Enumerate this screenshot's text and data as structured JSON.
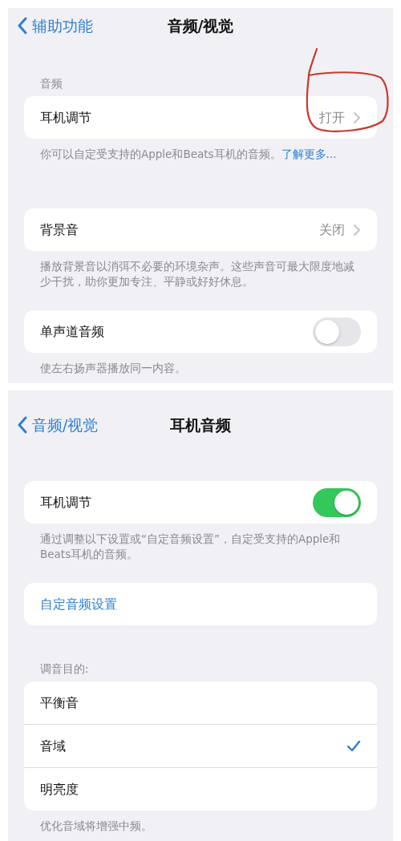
{
  "screens": [
    {
      "nav": {
        "back": "辅助功能",
        "title": "音频/视觉"
      },
      "groups": [
        {
          "header": "音频",
          "rows": [
            {
              "kind": "value",
              "label": "耳机调节",
              "value": "打开",
              "annotation": {
                "kind": "circle"
              }
            }
          ],
          "footer": "你可以自定受支持的Apple和Beats耳机的音频。",
          "footer_link": "了解更多..."
        },
        {
          "rows": [
            {
              "kind": "value",
              "label": "背景音",
              "value": "关闭"
            }
          ],
          "footer": "播放背景音以消弭不必要的环境杂声。这些声音可最大限度地减少干扰，助你更加专注、平静或好好休息。"
        },
        {
          "rows": [
            {
              "kind": "switch",
              "label": "单声道音频",
              "on": false
            }
          ],
          "footer": "使左右扬声器播放同一内容。"
        }
      ]
    },
    {
      "nav": {
        "back": "音频/视觉",
        "title": "耳机音频"
      },
      "groups": [
        {
          "rows": [
            {
              "kind": "switch",
              "label": "耳机调节",
              "on": true
            }
          ],
          "footer": "通过调整以下设置或“自定音频设置”，自定受支持的Apple和Beats耳机的音频。"
        },
        {
          "rows": [
            {
              "kind": "link",
              "label": "自定音频设置"
            }
          ]
        },
        {
          "header": "调音目的:",
          "rows": [
            {
              "kind": "option",
              "label": "平衡音",
              "selected": false
            },
            {
              "kind": "option",
              "label": "音域",
              "selected": true
            },
            {
              "kind": "option",
              "label": "明亮度",
              "selected": false
            }
          ],
          "footer": "优化音域将增强中频。"
        }
      ]
    }
  ]
}
